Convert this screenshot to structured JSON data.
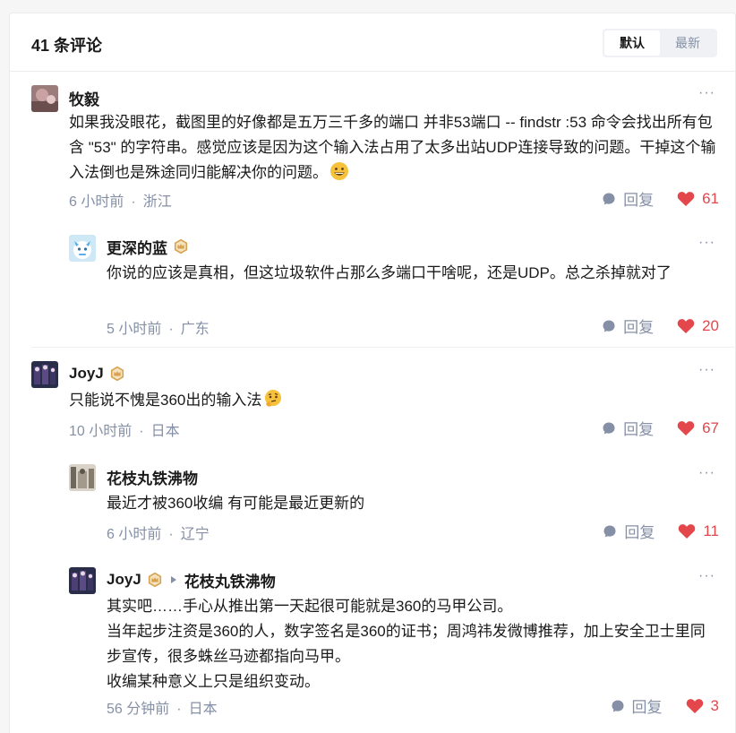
{
  "header": {
    "title": "41 条评论",
    "sort_default": "默认",
    "sort_latest": "最新"
  },
  "comments": [
    {
      "name": "牧毅",
      "text": "如果我没眼花，截图里的好像都是五万三千多的端口 并非53端口 -- findstr :53 命令会找出所有包含 \"53\" 的字符串。感觉应该是因为这个输入法占用了太多出站UDP连接导致的问题。干掉这个输入法倒也是殊途同归能解决你的问题。",
      "time": "6 小时前",
      "location": "浙江",
      "reply_label": "回复",
      "likes": "61"
    },
    {
      "name": "更深的蓝",
      "text": "你说的应该是真相，但这垃圾软件占那么多端口干啥呢，还是UDP。总之杀掉就对了",
      "time": "5 小时前",
      "location": "广东",
      "reply_label": "回复",
      "likes": "20"
    },
    {
      "name": "JoyJ",
      "text": "只能说不愧是360出的输入法",
      "time": "10 小时前",
      "location": "日本",
      "reply_label": "回复",
      "likes": "67"
    },
    {
      "name": "花枝丸铁沸物",
      "text": "最近才被360收编 有可能是最近更新的",
      "time": "6 小时前",
      "location": "辽宁",
      "reply_label": "回复",
      "likes": "11"
    },
    {
      "name": "JoyJ",
      "reply_to": "花枝丸铁沸物",
      "lines": [
        "其实吧……手心从推出第一天起很可能就是360的马甲公司。",
        "当年起步注资是360的人，数字签名是360的证书；周鸿祎发微博推荐，加上安全卫士里同步宣传，很多蛛丝马迹都指向马甲。",
        "收编某种意义上只是组织变动。"
      ],
      "time": "56 分钟前",
      "location": "日本",
      "reply_label": "回复",
      "likes": "3"
    }
  ],
  "more_label": "···",
  "dot": "·",
  "icons": {
    "reply": "reply-bubble-icon",
    "like": "heart-icon",
    "badge": "crown-badge-icon",
    "emoji_grin": "grinning-face-icon",
    "emoji_thinking": "thinking-face-icon"
  },
  "colors": {
    "like": "#e3464b",
    "meta": "#8590a6",
    "badge": "#d6a24f"
  }
}
